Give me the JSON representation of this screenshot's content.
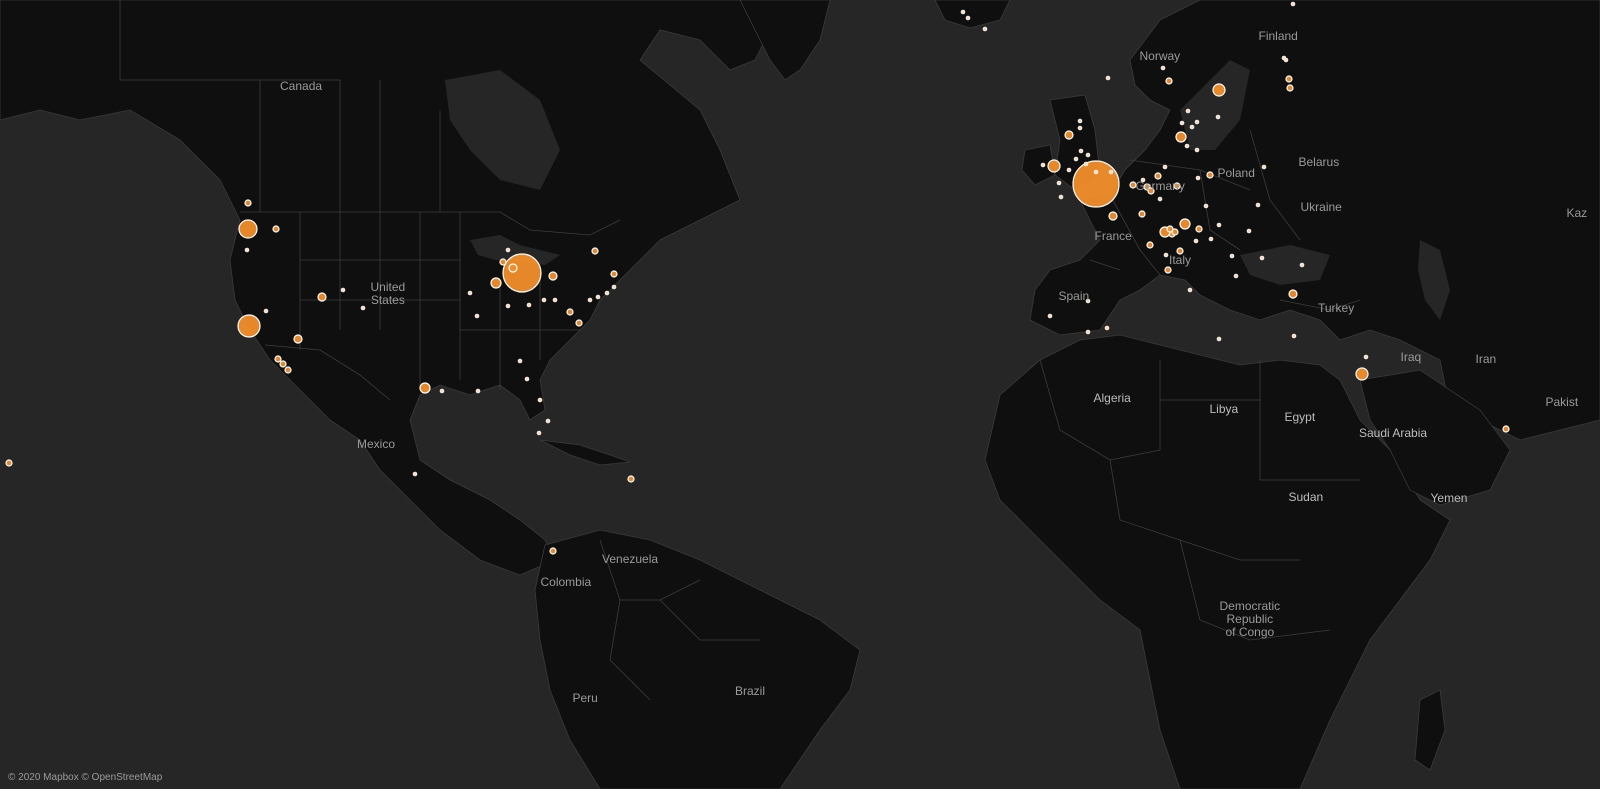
{
  "map": {
    "labels": {
      "canada": "Canada",
      "united_states": "United\nStates",
      "mexico": "Mexico",
      "venezuela": "Venezuela",
      "colombia": "Colombia",
      "peru": "Peru",
      "brazil": "Brazil",
      "norway": "Norway",
      "finland": "Finland",
      "belarus": "Belarus",
      "poland": "Poland",
      "germany": "Germany",
      "ukraine": "Ukraine",
      "france": "France",
      "italy": "Italy",
      "spain": "Spain",
      "turkey": "Turkey",
      "kazakhstan_partial": "Kaz",
      "iraq": "Iraq",
      "iran": "Iran",
      "pakistan_partial": "Pakist",
      "algeria": "Algeria",
      "libya": "Libya",
      "egypt": "Egypt",
      "saudi_arabia": "Saudi Arabia",
      "yemen": "Yemen",
      "sudan": "Sudan",
      "drc": "Democratic\nRepublic\nof Congo"
    },
    "attribution": "© 2020 Mapbox © OpenStreetMap",
    "marker_color": "#f28e2b",
    "marker_stroke": "#ffffff"
  }
}
